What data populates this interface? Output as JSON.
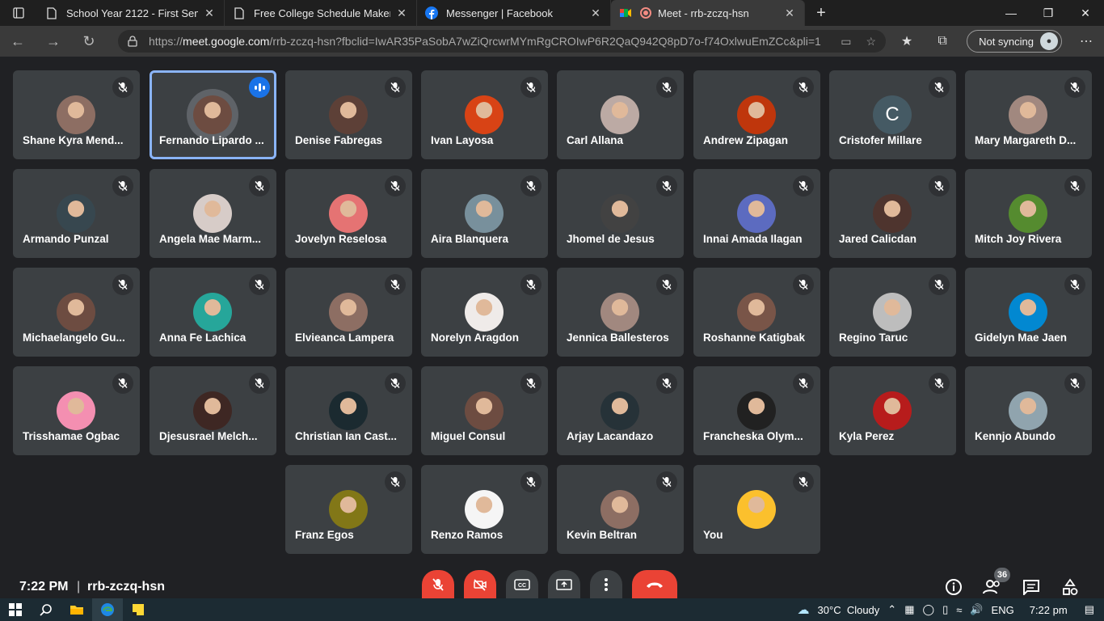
{
  "browser": {
    "tabs": [
      {
        "title": "School Year 2122 - First Semeste",
        "icon": "document-icon",
        "active": false
      },
      {
        "title": "Free College Schedule Maker",
        "icon": "document-icon",
        "active": false
      },
      {
        "title": "Messenger | Facebook",
        "icon": "facebook-icon",
        "active": false
      },
      {
        "title": "Meet - rrb-zczq-hsn",
        "icon": "meet-icon",
        "active": true
      }
    ],
    "url_prefix": "https://",
    "url_host": "meet.google.com",
    "url_path": "/rrb-zczq-hsn?fbclid=IwAR35PaSobA7wZiQrcwrMYmRgCROIwP6R2QaQ942Q8pD7o-f74OxlwuEmZCc&pli=1",
    "sync_label": "Not syncing"
  },
  "participants": [
    {
      "name": "Shane Kyra Mend...",
      "color": "#8d6e63"
    },
    {
      "name": "Fernando Lipardo ...",
      "color": "#6d4c41",
      "speaking": true
    },
    {
      "name": "Denise Fabregas",
      "color": "#5d4037"
    },
    {
      "name": "Ivan Layosa",
      "color": "#d84315"
    },
    {
      "name": "Carl Allana",
      "color": "#bcaaa4"
    },
    {
      "name": "Andrew Zipagan",
      "color": "#bf360c"
    },
    {
      "name": "Cristofer Millare",
      "color": "#455a64",
      "initial": "C"
    },
    {
      "name": "Mary Margareth D...",
      "color": "#a1887f"
    },
    {
      "name": "Armando Punzal",
      "color": "#37474f"
    },
    {
      "name": "Angela Mae Marm...",
      "color": "#d7ccc8"
    },
    {
      "name": "Jovelyn Reselosa",
      "color": "#e57373"
    },
    {
      "name": "Aira Blanquera",
      "color": "#78909c"
    },
    {
      "name": "Jhomel de Jesus",
      "color": "#424242"
    },
    {
      "name": "Innai Amada Ilagan",
      "color": "#5c6bc0"
    },
    {
      "name": "Jared Calicdan",
      "color": "#4e342e"
    },
    {
      "name": "Mitch Joy Rivera",
      "color": "#558b2f"
    },
    {
      "name": "Michaelangelo Gu...",
      "color": "#6d4c41"
    },
    {
      "name": "Anna Fe Lachica",
      "color": "#26a69a"
    },
    {
      "name": "Elvieanca Lampera",
      "color": "#8d6e63"
    },
    {
      "name": "Norelyn Aragdon",
      "color": "#efebe9"
    },
    {
      "name": "Jennica Ballesteros",
      "color": "#a1887f"
    },
    {
      "name": "Roshanne Katigbak",
      "color": "#795548"
    },
    {
      "name": "Regino Taruc",
      "color": "#bdbdbd"
    },
    {
      "name": "Gidelyn Mae Jaen",
      "color": "#0288d1"
    },
    {
      "name": "Trisshamae Ogbac",
      "color": "#f48fb1"
    },
    {
      "name": "Djesusrael Melch...",
      "color": "#3e2723"
    },
    {
      "name": "Christian Ian Cast...",
      "color": "#1b2a30"
    },
    {
      "name": "Miguel Consul",
      "color": "#6d4c41"
    },
    {
      "name": "Arjay Lacandazo",
      "color": "#263238"
    },
    {
      "name": "Francheska Olym...",
      "color": "#212121"
    },
    {
      "name": "Kyla Perez",
      "color": "#b71c1c"
    },
    {
      "name": "Kennjo Abundo",
      "color": "#90a4ae"
    },
    {
      "name": "Franz Egos",
      "color": "#827717"
    },
    {
      "name": "Renzo Ramos",
      "color": "#f5f5f5"
    },
    {
      "name": "Kevin Beltran",
      "color": "#8d6e63"
    },
    {
      "name": "You",
      "color": "#fbc02d"
    }
  ],
  "meeting": {
    "time": "7:22 PM",
    "separator": "|",
    "code": "rrb-zczq-hsn",
    "participant_count": "36"
  },
  "taskbar": {
    "weather": "30°C  Cloudy",
    "language": "ENG",
    "clock": "7:22 pm"
  }
}
